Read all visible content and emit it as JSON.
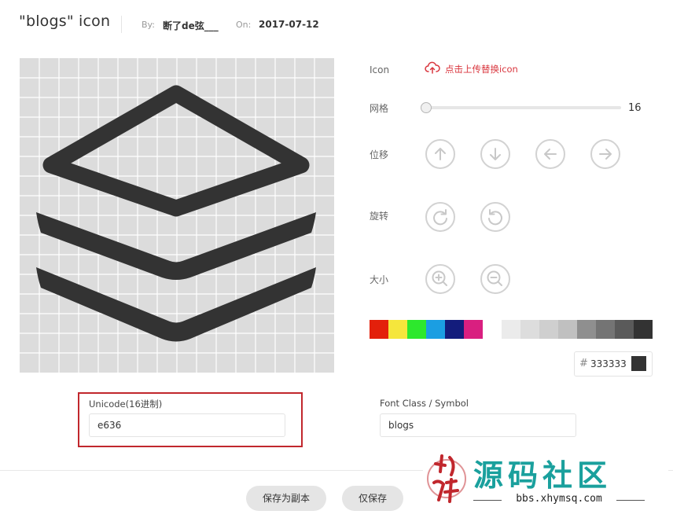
{
  "header": {
    "title": "\"blogs\"  icon",
    "by_label": "By:",
    "author": "断了de弦___",
    "on_label": "On:",
    "date": "2017-07-12"
  },
  "editor": {
    "icon_label": "Icon",
    "upload_label": "点击上传替换icon",
    "grid_label": "网格",
    "grid_value": "16",
    "grid_slider_fraction": 0,
    "move_label": "位移",
    "rotate_label": "旋转",
    "size_label": "大小",
    "move_buttons": [
      "arrow-up-icon",
      "arrow-down-icon",
      "arrow-left-icon",
      "arrow-right-icon"
    ],
    "rotate_buttons": [
      "rotate-clockwise-icon",
      "rotate-counterclockwise-icon"
    ],
    "size_buttons": [
      "zoom-in-icon",
      "zoom-out-icon"
    ],
    "icon_color": "#333333",
    "accent_color": "#d9363e"
  },
  "colors": {
    "swatches": [
      "#e3200b",
      "#f5e63c",
      "#2de82d",
      "#1b9ee2",
      "#131c7c",
      "#d91f80",
      "#ffffff",
      "#ebebeb",
      "#dddddd",
      "#cfcfcf",
      "#c0c0c0",
      "#8f8f8f",
      "#747474",
      "#5a5a5a",
      "#333333"
    ],
    "hash": "#",
    "hex_value": "333333"
  },
  "fields": {
    "unicode_label": "Unicode(16进制)",
    "unicode_value": "e636",
    "fontclass_label": "Font Class / Symbol",
    "fontclass_value": "blogs"
  },
  "footer": {
    "save_copy_label": "保存为副本",
    "save_label": "仅保存"
  },
  "watermark": {
    "text": "源码社区",
    "url": "bbs.xhymsq.com",
    "seal_text": "小体"
  }
}
